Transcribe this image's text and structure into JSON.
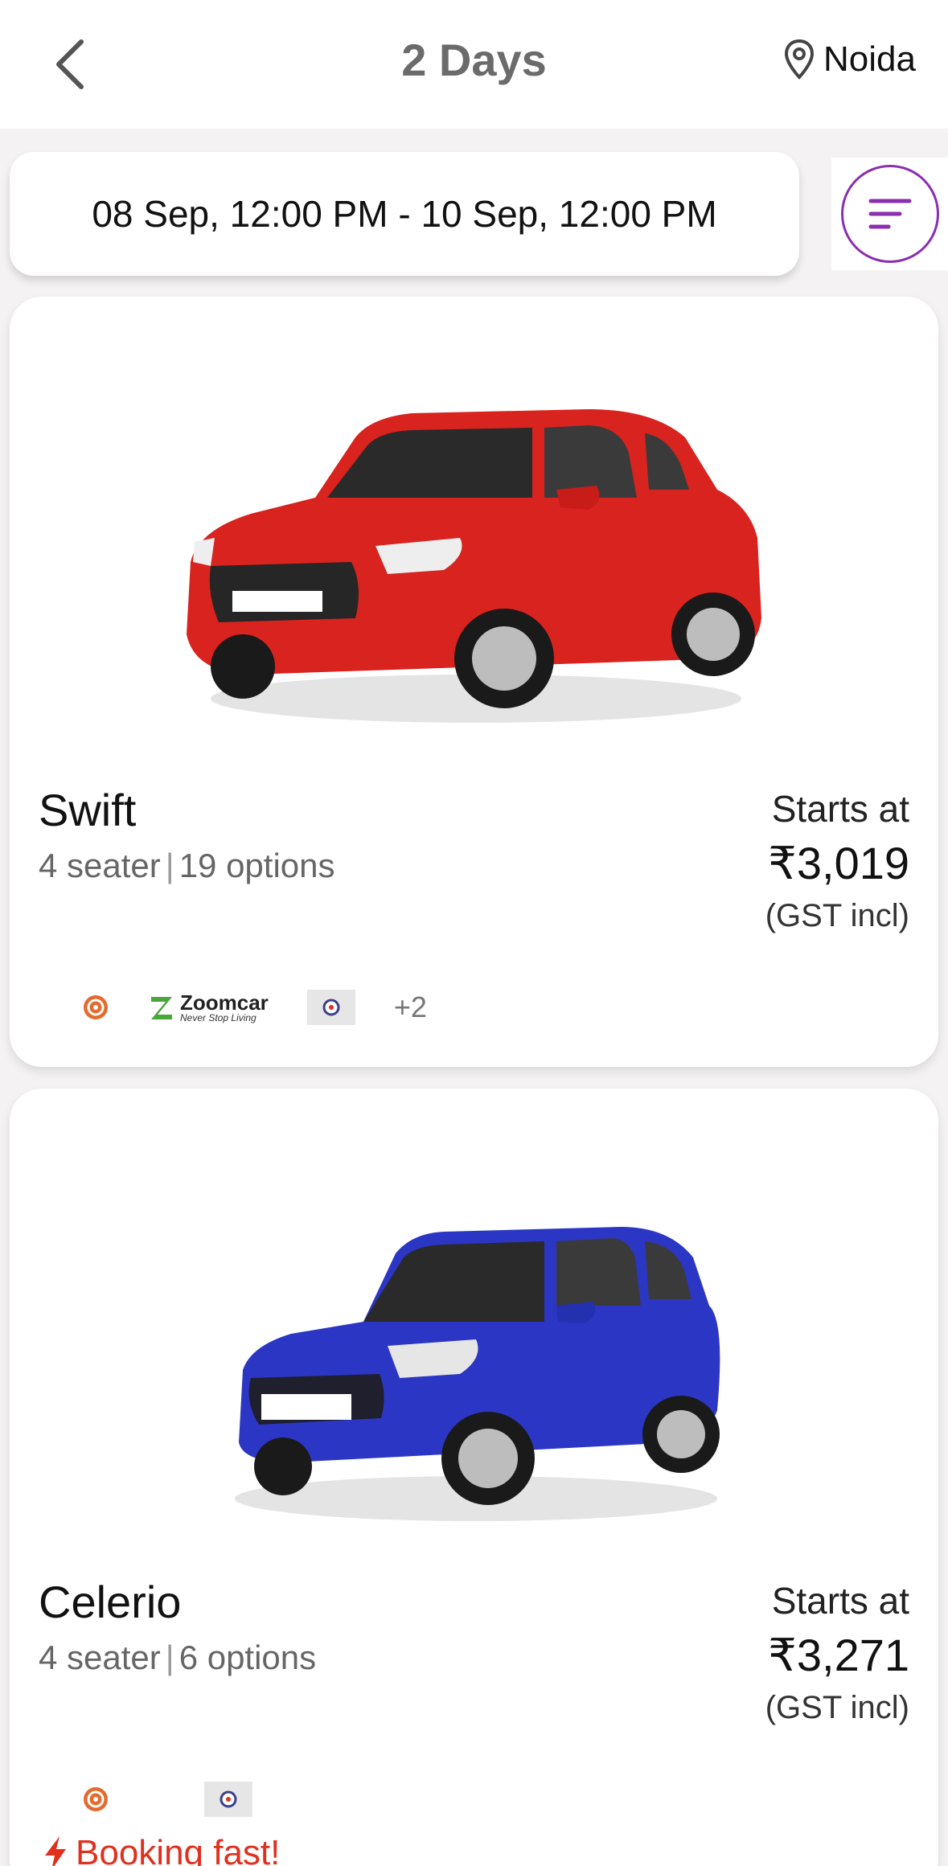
{
  "header": {
    "title": "2 Days",
    "location": "Noida"
  },
  "date_range": "08 Sep, 12:00 PM - 10 Sep, 12:00 PM",
  "colors": {
    "accent": "#8a2fb0",
    "alert": "#e0301e",
    "card_bg": "#ffffff",
    "page_bg": "#f4f2f2"
  },
  "cars": [
    {
      "name": "Swift",
      "seats": "4 seater",
      "options": "19 options",
      "starts_label": "Starts at",
      "price": "₹3,019",
      "tax_note": "(GST incl)",
      "color": "#d8231f",
      "providers": {
        "zoomcar_name": "Zoomcar",
        "zoomcar_tagline": "Never Stop Living",
        "more": "+2"
      }
    },
    {
      "name": "Celerio",
      "seats": "4 seater",
      "options": "6 options",
      "starts_label": "Starts at",
      "price": "₹3,271",
      "tax_note": "(GST incl)",
      "color": "#2b37c4",
      "badge": "Booking fast!"
    }
  ]
}
